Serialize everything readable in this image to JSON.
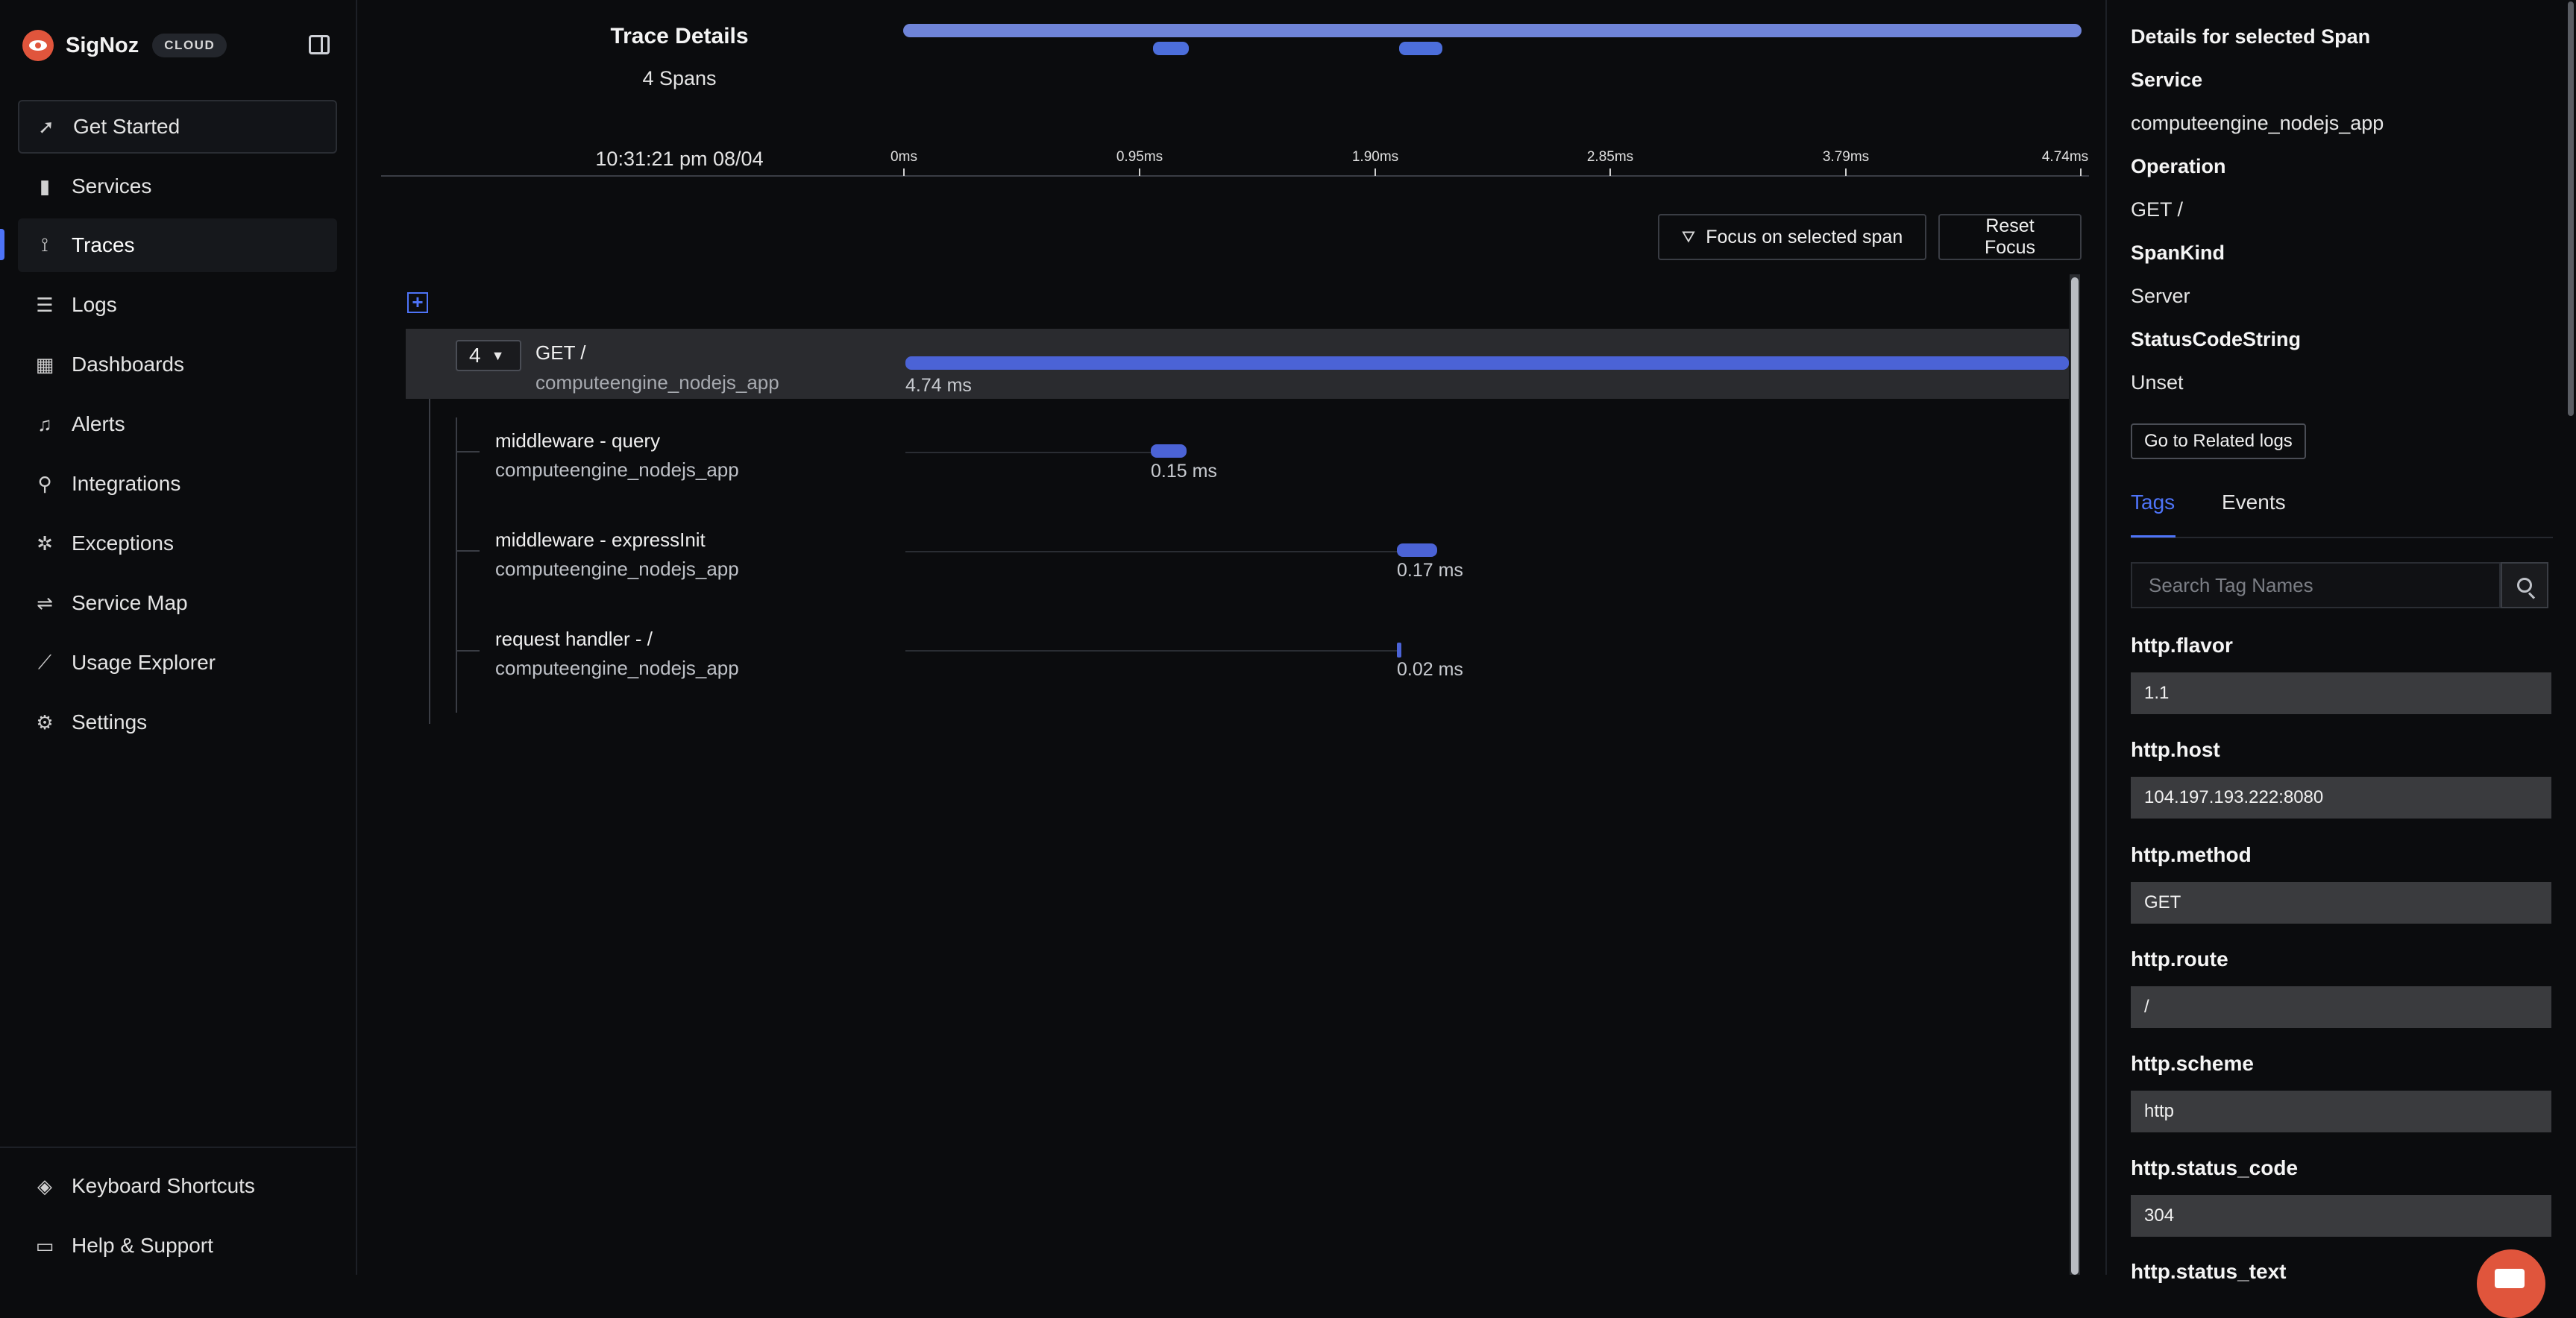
{
  "sidebar": {
    "brand": "SigNoz",
    "badge": "CLOUD",
    "items": [
      {
        "label": "Get Started",
        "icon": "rocket-icon"
      },
      {
        "label": "Services",
        "icon": "bar-chart-icon"
      },
      {
        "label": "Traces",
        "icon": "traces-icon"
      },
      {
        "label": "Logs",
        "icon": "logs-icon"
      },
      {
        "label": "Dashboards",
        "icon": "dashboard-icon"
      },
      {
        "label": "Alerts",
        "icon": "bell-icon"
      },
      {
        "label": "Integrations",
        "icon": "plug-icon"
      },
      {
        "label": "Exceptions",
        "icon": "bug-icon"
      },
      {
        "label": "Service Map",
        "icon": "route-icon"
      },
      {
        "label": "Usage Explorer",
        "icon": "line-chart-icon"
      },
      {
        "label": "Settings",
        "icon": "gear-icon"
      }
    ],
    "footer": [
      {
        "label": "Keyboard Shortcuts",
        "icon": "layers-icon"
      },
      {
        "label": "Help & Support",
        "icon": "message-icon"
      }
    ],
    "active": "Traces"
  },
  "trace": {
    "title": "Trace Details",
    "span_count": "4 Spans",
    "timestamp": "10:31:21 pm 08/04",
    "ticks": [
      "0ms",
      "0.95ms",
      "1.90ms",
      "2.85ms",
      "3.79ms",
      "4.74ms"
    ],
    "focus_button": "Focus on selected span",
    "reset_button": "Reset Focus",
    "total_duration_ms": 4.74,
    "root": {
      "child_count": "4",
      "name": "GET /",
      "service": "computeengine_nodejs_app",
      "duration": "4.74 ms",
      "start_ms": 0,
      "duration_ms": 4.74
    },
    "children": [
      {
        "name": "middleware - query",
        "service": "computeengine_nodejs_app",
        "duration": "0.15 ms",
        "start_ms": 1.0,
        "duration_ms": 0.15
      },
      {
        "name": "middleware - expressInit",
        "service": "computeengine_nodejs_app",
        "duration": "0.17 ms",
        "start_ms": 2.0,
        "duration_ms": 0.17
      },
      {
        "name": "request handler - /",
        "service": "computeengine_nodejs_app",
        "duration": "0.02 ms",
        "start_ms": 2.0,
        "duration_ms": 0.02
      }
    ]
  },
  "details": {
    "title": "Details for selected Span",
    "fields": [
      {
        "label": "Service",
        "value": "computeengine_nodejs_app"
      },
      {
        "label": "Operation",
        "value": "GET /"
      },
      {
        "label": "SpanKind",
        "value": "Server"
      },
      {
        "label": "StatusCodeString",
        "value": "Unset"
      }
    ],
    "related_logs_button": "Go to Related logs",
    "tabs": [
      "Tags",
      "Events"
    ],
    "active_tab": "Tags",
    "search_placeholder": "Search Tag Names",
    "tags": [
      {
        "key": "http.flavor",
        "value": "1.1"
      },
      {
        "key": "http.host",
        "value": "104.197.193.222:8080"
      },
      {
        "key": "http.method",
        "value": "GET"
      },
      {
        "key": "http.route",
        "value": "/"
      },
      {
        "key": "http.scheme",
        "value": "http"
      },
      {
        "key": "http.status_code",
        "value": "304"
      },
      {
        "key": "http.status_text",
        "value": ""
      }
    ]
  },
  "colors": {
    "accent": "#4e74f8",
    "span_bar": "#4b63d6",
    "brand": "#e0553c"
  }
}
